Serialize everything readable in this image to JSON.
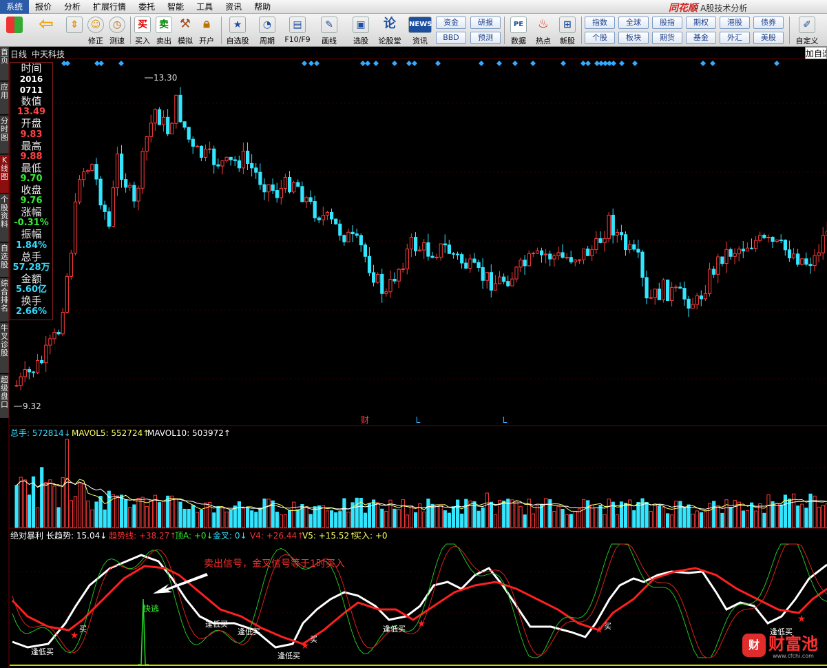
{
  "menu": [
    "系统",
    "报价",
    "分析",
    "扩展行情",
    "委托",
    "智能",
    "工具",
    "资讯",
    "帮助"
  ],
  "brand": "同花顺",
  "window_title": "- A股技术分析",
  "toolbar": {
    "buttons": [
      {
        "label": "",
        "icon": "quad-grid-icon"
      },
      {
        "label": "",
        "icon": "back-arrow-icon"
      },
      {
        "label": "修正",
        "icon": "up-down-arrow-icon"
      },
      {
        "label": "修正",
        "icon": "smile-icon"
      },
      {
        "label": "测速",
        "icon": "clock-icon"
      },
      {
        "label": "买入",
        "icon": "buy-icon",
        "glyph": "买"
      },
      {
        "label": "卖出",
        "icon": "sell-icon",
        "glyph": "卖"
      },
      {
        "label": "模拟",
        "icon": "hammer-icon"
      },
      {
        "label": "开户",
        "icon": "lock-icon"
      },
      {
        "label": "自选股",
        "icon": "star-icon"
      },
      {
        "label": "周期",
        "icon": "cycle-icon"
      },
      {
        "label": "F10/F9",
        "icon": "f10-icon"
      },
      {
        "label": "画线",
        "icon": "pen-icon"
      },
      {
        "label": "选股",
        "icon": "monitor-icon"
      },
      {
        "label": "论股堂",
        "icon": "forum-icon"
      },
      {
        "label": "资讯",
        "icon": "news-icon",
        "glyph": "NEWS"
      },
      {
        "label": "数据",
        "icon": "pe-icon",
        "glyph": "PE"
      },
      {
        "label": "热点",
        "icon": "hot-icon"
      },
      {
        "label": "新股",
        "icon": "new-stock-icon"
      },
      {
        "label": "自定义",
        "icon": "edit-icon"
      }
    ],
    "small_buttons": [
      "资金",
      "研报",
      "BBD",
      "预测",
      "指数",
      "全球",
      "股指",
      "期权",
      "港股",
      "债券",
      "个股",
      "板块",
      "期货",
      "基金",
      "外汇",
      "美股"
    ]
  },
  "left_tabs": [
    "首页",
    "应用",
    "分时图",
    "K线图",
    "个股资料",
    "自选股",
    "综合排名",
    "牛叉诊股",
    "超级盘口"
  ],
  "header": {
    "period": "日线",
    "stock": "中天科技",
    "add": "加自选"
  },
  "info_panel": {
    "time_label": "时间",
    "date_year": "2016",
    "date_md": "0711",
    "value_label": "数值",
    "value": "13.49",
    "open_label": "开盘",
    "open": "9.83",
    "high_label": "最高",
    "high": "9.88",
    "low_label": "最低",
    "low": "9.70",
    "close_label": "收盘",
    "close": "9.76",
    "change_label": "涨幅",
    "change": "-0.31%",
    "amplitude_label": "振幅",
    "amplitude": "1.84%",
    "volume_label": "总手",
    "volume": "57.28万",
    "amount_label": "金额",
    "amount": "5.60亿",
    "turnover_label": "换手",
    "turnover": "2.66%"
  },
  "price_chart": {
    "max_price": "13.30",
    "min_price": "9.32",
    "markers": [
      "财",
      "L",
      "L"
    ]
  },
  "volume_panel": {
    "vol_label": "总手: 572814",
    "mavol5_label": "MAVOL5: 552724",
    "mavol10_label": "MAVOL10: 503972",
    "colors": {
      "up": "#ff3c3c",
      "down": "#33e6ff",
      "ma5": "#ffff66",
      "ma10": "#ffffff"
    }
  },
  "indicator_panel": {
    "name": "绝对暴利",
    "long_trend": "长趋势: 15.04",
    "trend_line": "趋势线: +38.27",
    "top_a": "顶A: +0",
    "golden_cross": "金叉: 0",
    "v4": "V4: +26.44",
    "v5": "V5: +15.52",
    "buy": "买入: +0",
    "annotation": "卖出信号，金叉信号等于1时买入",
    "labels": {
      "buy": "买",
      "low_buy": "逢低买",
      "fast_escape": "快逃"
    },
    "colors": {
      "trend": "#ff2020",
      "white": "#ffffff",
      "green": "#22c522",
      "red_thin": "#e02020"
    }
  },
  "watermark": {
    "logo": "财",
    "text": "财富池",
    "url": "www.cfchi.com"
  }
}
